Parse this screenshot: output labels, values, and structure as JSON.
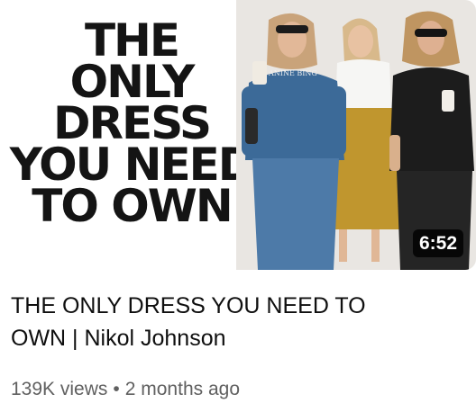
{
  "thumbnail": {
    "headline_lines": [
      "THE",
      "ONLY",
      "DRESS",
      "YOU NEED",
      "TO OWN"
    ],
    "sweatshirt_text": "ANINE BING",
    "duration": "6:52"
  },
  "video": {
    "title": "THE ONLY DRESS YOU NEED TO OWN | Nikol Johnson",
    "views": "139K views",
    "separator": "•",
    "age": "2 months ago"
  }
}
